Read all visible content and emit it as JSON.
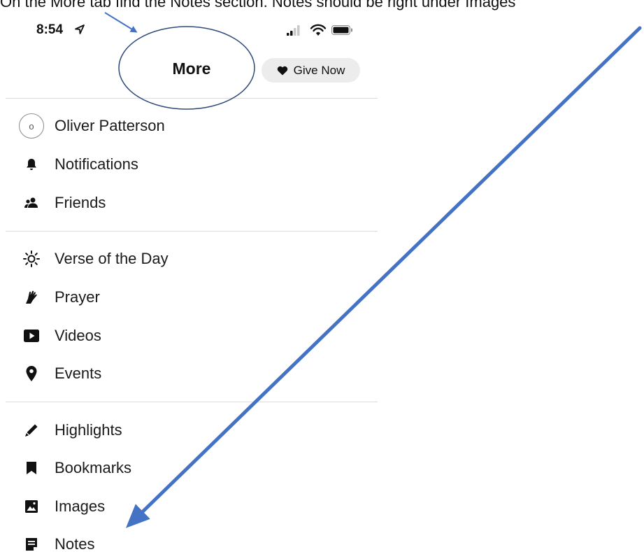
{
  "instruction": "On the More tab find the Notes section. Notes should be right under Images",
  "status_bar": {
    "time": "8:54",
    "icons": [
      "location-arrow-icon",
      "cellular-signal-icon",
      "wifi-icon",
      "battery-icon"
    ]
  },
  "header": {
    "title": "More",
    "give_now_label": "Give Now",
    "give_now_icon": "heart-icon"
  },
  "profile": {
    "avatar_initial": "o",
    "name": "Oliver Patterson"
  },
  "menu": {
    "notifications": {
      "label": "Notifications",
      "icon": "bell-icon"
    },
    "friends": {
      "label": "Friends",
      "icon": "friends-icon"
    },
    "verse_of_the_day": {
      "label": "Verse of the Day",
      "icon": "sun-icon"
    },
    "prayer": {
      "label": "Prayer",
      "icon": "praying-hands-icon"
    },
    "videos": {
      "label": "Videos",
      "icon": "play-icon"
    },
    "events": {
      "label": "Events",
      "icon": "map-pin-icon"
    },
    "highlights": {
      "label": "Highlights",
      "icon": "pen-icon"
    },
    "bookmarks": {
      "label": "Bookmarks",
      "icon": "bookmark-icon"
    },
    "images": {
      "label": "Images",
      "icon": "image-icon"
    },
    "notes": {
      "label": "Notes",
      "icon": "note-icon"
    }
  },
  "colors": {
    "annotation_blue": "#4472C4",
    "ellipse_stroke": "#2F4A7A",
    "pill_background": "#ECECEC",
    "divider": "#DCDCDC"
  }
}
